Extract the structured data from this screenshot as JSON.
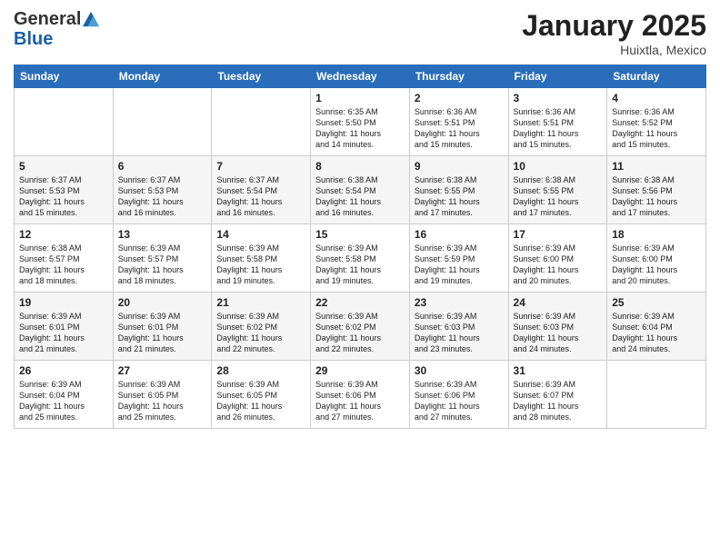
{
  "logo": {
    "general": "General",
    "blue": "Blue"
  },
  "header": {
    "title": "January 2025",
    "location": "Huixtla, Mexico"
  },
  "weekdays": [
    "Sunday",
    "Monday",
    "Tuesday",
    "Wednesday",
    "Thursday",
    "Friday",
    "Saturday"
  ],
  "weeks": [
    [
      {
        "day": "",
        "info": ""
      },
      {
        "day": "",
        "info": ""
      },
      {
        "day": "",
        "info": ""
      },
      {
        "day": "1",
        "info": "Sunrise: 6:35 AM\nSunset: 5:50 PM\nDaylight: 11 hours\nand 14 minutes."
      },
      {
        "day": "2",
        "info": "Sunrise: 6:36 AM\nSunset: 5:51 PM\nDaylight: 11 hours\nand 15 minutes."
      },
      {
        "day": "3",
        "info": "Sunrise: 6:36 AM\nSunset: 5:51 PM\nDaylight: 11 hours\nand 15 minutes."
      },
      {
        "day": "4",
        "info": "Sunrise: 6:36 AM\nSunset: 5:52 PM\nDaylight: 11 hours\nand 15 minutes."
      }
    ],
    [
      {
        "day": "5",
        "info": "Sunrise: 6:37 AM\nSunset: 5:53 PM\nDaylight: 11 hours\nand 15 minutes."
      },
      {
        "day": "6",
        "info": "Sunrise: 6:37 AM\nSunset: 5:53 PM\nDaylight: 11 hours\nand 16 minutes."
      },
      {
        "day": "7",
        "info": "Sunrise: 6:37 AM\nSunset: 5:54 PM\nDaylight: 11 hours\nand 16 minutes."
      },
      {
        "day": "8",
        "info": "Sunrise: 6:38 AM\nSunset: 5:54 PM\nDaylight: 11 hours\nand 16 minutes."
      },
      {
        "day": "9",
        "info": "Sunrise: 6:38 AM\nSunset: 5:55 PM\nDaylight: 11 hours\nand 17 minutes."
      },
      {
        "day": "10",
        "info": "Sunrise: 6:38 AM\nSunset: 5:55 PM\nDaylight: 11 hours\nand 17 minutes."
      },
      {
        "day": "11",
        "info": "Sunrise: 6:38 AM\nSunset: 5:56 PM\nDaylight: 11 hours\nand 17 minutes."
      }
    ],
    [
      {
        "day": "12",
        "info": "Sunrise: 6:38 AM\nSunset: 5:57 PM\nDaylight: 11 hours\nand 18 minutes."
      },
      {
        "day": "13",
        "info": "Sunrise: 6:39 AM\nSunset: 5:57 PM\nDaylight: 11 hours\nand 18 minutes."
      },
      {
        "day": "14",
        "info": "Sunrise: 6:39 AM\nSunset: 5:58 PM\nDaylight: 11 hours\nand 19 minutes."
      },
      {
        "day": "15",
        "info": "Sunrise: 6:39 AM\nSunset: 5:58 PM\nDaylight: 11 hours\nand 19 minutes."
      },
      {
        "day": "16",
        "info": "Sunrise: 6:39 AM\nSunset: 5:59 PM\nDaylight: 11 hours\nand 19 minutes."
      },
      {
        "day": "17",
        "info": "Sunrise: 6:39 AM\nSunset: 6:00 PM\nDaylight: 11 hours\nand 20 minutes."
      },
      {
        "day": "18",
        "info": "Sunrise: 6:39 AM\nSunset: 6:00 PM\nDaylight: 11 hours\nand 20 minutes."
      }
    ],
    [
      {
        "day": "19",
        "info": "Sunrise: 6:39 AM\nSunset: 6:01 PM\nDaylight: 11 hours\nand 21 minutes."
      },
      {
        "day": "20",
        "info": "Sunrise: 6:39 AM\nSunset: 6:01 PM\nDaylight: 11 hours\nand 21 minutes."
      },
      {
        "day": "21",
        "info": "Sunrise: 6:39 AM\nSunset: 6:02 PM\nDaylight: 11 hours\nand 22 minutes."
      },
      {
        "day": "22",
        "info": "Sunrise: 6:39 AM\nSunset: 6:02 PM\nDaylight: 11 hours\nand 22 minutes."
      },
      {
        "day": "23",
        "info": "Sunrise: 6:39 AM\nSunset: 6:03 PM\nDaylight: 11 hours\nand 23 minutes."
      },
      {
        "day": "24",
        "info": "Sunrise: 6:39 AM\nSunset: 6:03 PM\nDaylight: 11 hours\nand 24 minutes."
      },
      {
        "day": "25",
        "info": "Sunrise: 6:39 AM\nSunset: 6:04 PM\nDaylight: 11 hours\nand 24 minutes."
      }
    ],
    [
      {
        "day": "26",
        "info": "Sunrise: 6:39 AM\nSunset: 6:04 PM\nDaylight: 11 hours\nand 25 minutes."
      },
      {
        "day": "27",
        "info": "Sunrise: 6:39 AM\nSunset: 6:05 PM\nDaylight: 11 hours\nand 25 minutes."
      },
      {
        "day": "28",
        "info": "Sunrise: 6:39 AM\nSunset: 6:05 PM\nDaylight: 11 hours\nand 26 minutes."
      },
      {
        "day": "29",
        "info": "Sunrise: 6:39 AM\nSunset: 6:06 PM\nDaylight: 11 hours\nand 27 minutes."
      },
      {
        "day": "30",
        "info": "Sunrise: 6:39 AM\nSunset: 6:06 PM\nDaylight: 11 hours\nand 27 minutes."
      },
      {
        "day": "31",
        "info": "Sunrise: 6:39 AM\nSunset: 6:07 PM\nDaylight: 11 hours\nand 28 minutes."
      },
      {
        "day": "",
        "info": ""
      }
    ]
  ]
}
